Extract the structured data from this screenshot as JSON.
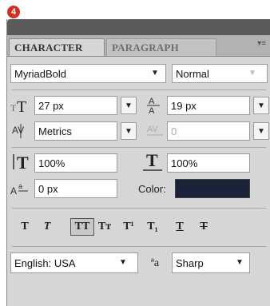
{
  "step_badge": "4",
  "tabs": {
    "character": "CHARACTER",
    "paragraph": "PARAGRAPH"
  },
  "font": {
    "family": "MyriadBold",
    "style": "Normal"
  },
  "size": {
    "font_size": "27 px",
    "leading": "19 px"
  },
  "kerning": {
    "kerning": "Metrics",
    "tracking": "0"
  },
  "scale": {
    "vertical": "100%",
    "horizontal": "100%"
  },
  "baseline": {
    "shift": "0 px",
    "color_label": "Color:",
    "color_value": "#1b2238"
  },
  "style_buttons": [
    {
      "name": "faux-bold-button",
      "glyph": "T"
    },
    {
      "name": "faux-italic-button",
      "glyph": "T"
    },
    {
      "name": "all-caps-button",
      "glyph": "TT"
    },
    {
      "name": "small-caps-button",
      "glyph": "Tт"
    },
    {
      "name": "superscript-button",
      "glyph": "T¹"
    },
    {
      "name": "subscript-button",
      "glyph": "T₁"
    },
    {
      "name": "underline-button",
      "glyph": "T"
    },
    {
      "name": "strikethrough-button",
      "glyph": "T"
    }
  ],
  "bottom": {
    "language": "English: USA",
    "antialias_icon": "ªa",
    "antialias": "Sharp"
  }
}
